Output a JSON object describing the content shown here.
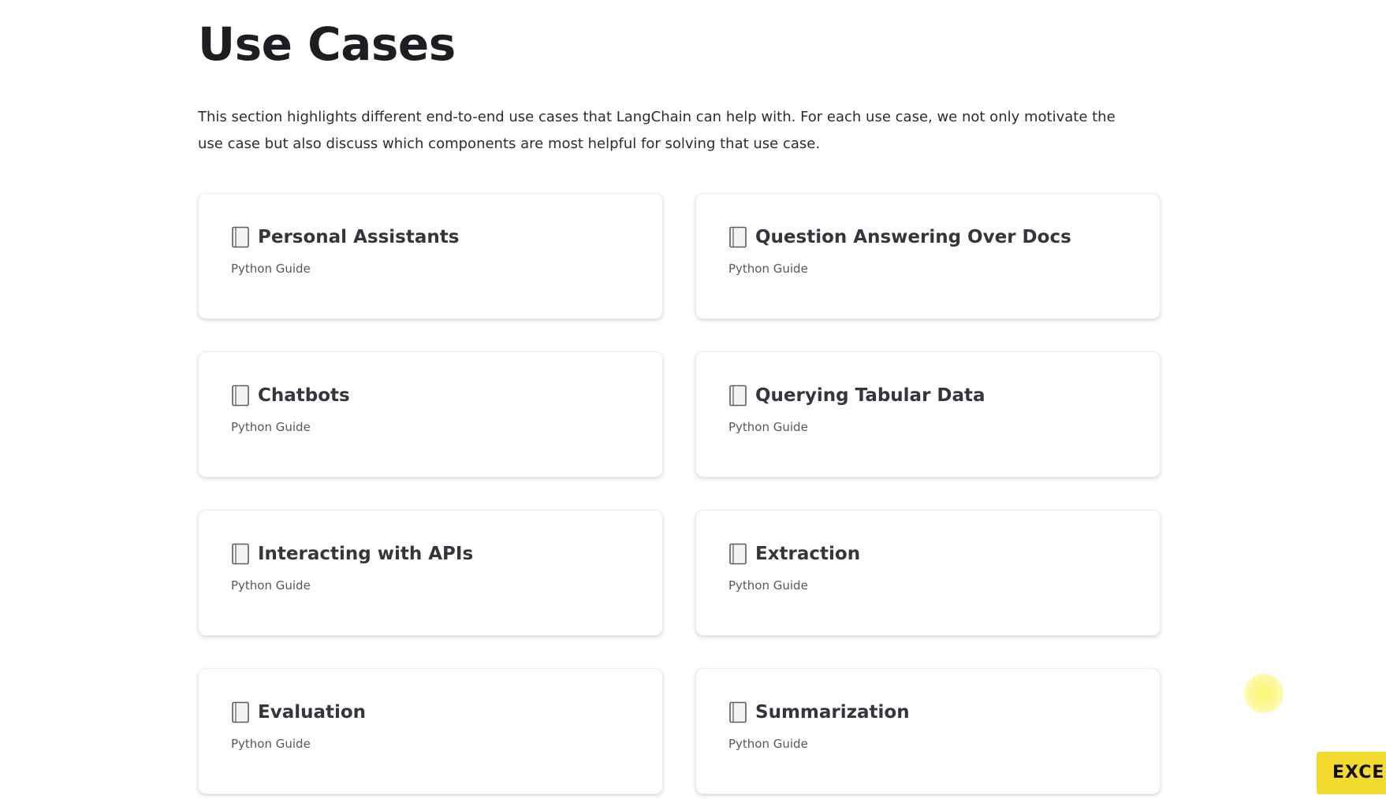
{
  "page": {
    "title": "Use Cases",
    "intro": "This section highlights different end-to-end use cases that LangChain can help with. For each use case, we not only motivate the use case but also discuss which components are most helpful for solving that use case."
  },
  "cards": [
    {
      "title": "Personal Assistants",
      "subtitle": "Python Guide",
      "icon": "document-icon"
    },
    {
      "title": "Question Answering Over Docs",
      "subtitle": "Python Guide",
      "icon": "document-icon"
    },
    {
      "title": "Chatbots",
      "subtitle": "Python Guide",
      "icon": "document-icon"
    },
    {
      "title": "Querying Tabular Data",
      "subtitle": "Python Guide",
      "icon": "document-icon"
    },
    {
      "title": "Interacting with APIs",
      "subtitle": "Python Guide",
      "icon": "document-icon"
    },
    {
      "title": "Extraction",
      "subtitle": "Python Guide",
      "icon": "document-icon"
    },
    {
      "title": "Evaluation",
      "subtitle": "Python Guide",
      "icon": "document-icon"
    },
    {
      "title": "Summarization",
      "subtitle": "Python Guide",
      "icon": "document-icon"
    }
  ],
  "overlay": {
    "badge_text": "EXCEL",
    "cursor_color": "#f8f45a",
    "badge_color": "#f2db2e"
  }
}
